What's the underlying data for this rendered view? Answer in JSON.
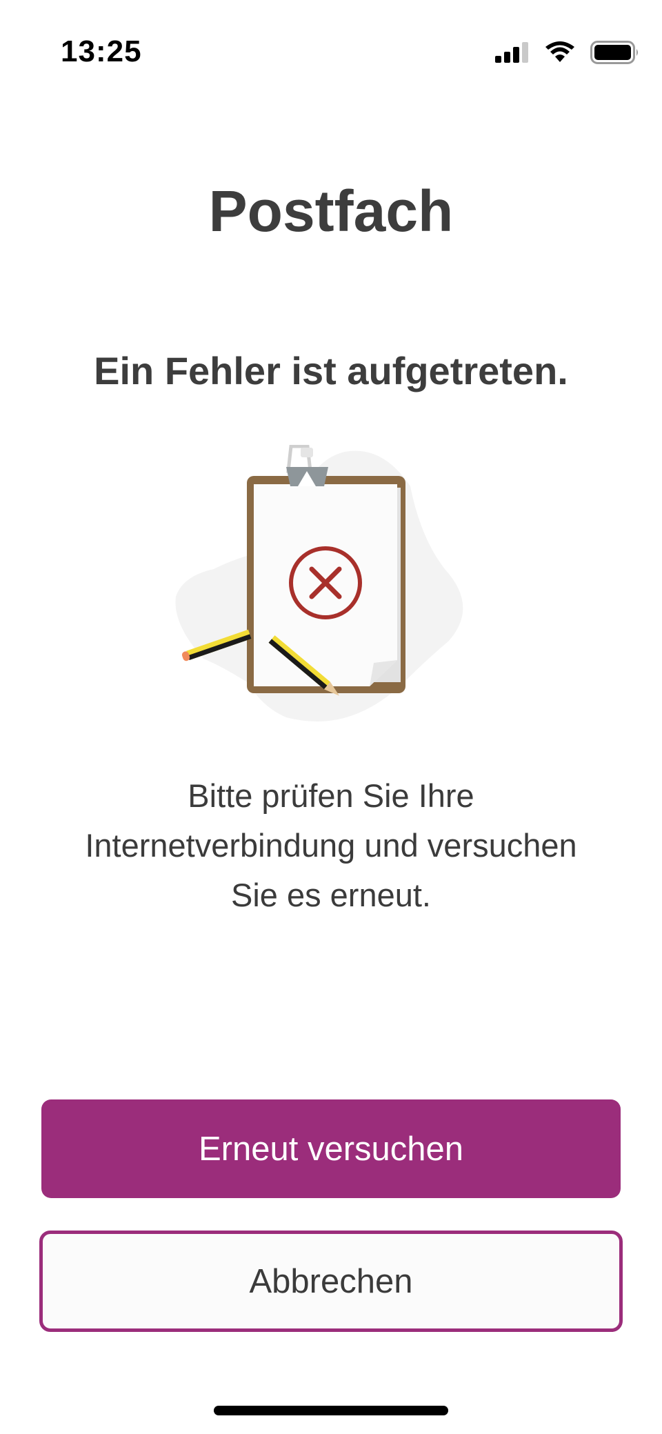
{
  "status_bar": {
    "time": "13:25",
    "icons": [
      "cellular-signal-icon",
      "wifi-icon",
      "battery-icon"
    ]
  },
  "page": {
    "title": "Postfach",
    "error_heading": "Ein Fehler ist aufgetreten.",
    "illustration": "clipboard-error-icon",
    "message_lines": [
      "Bitte prüfen Sie Ihre",
      "Internetverbindung und versuchen",
      "Sie es erneut."
    ]
  },
  "actions": {
    "retry_label": "Erneut versuchen",
    "cancel_label": "Abbrechen"
  },
  "colors": {
    "accent": "#9b2d7b",
    "text": "#3b3b3b",
    "error_red": "#a8302b"
  }
}
